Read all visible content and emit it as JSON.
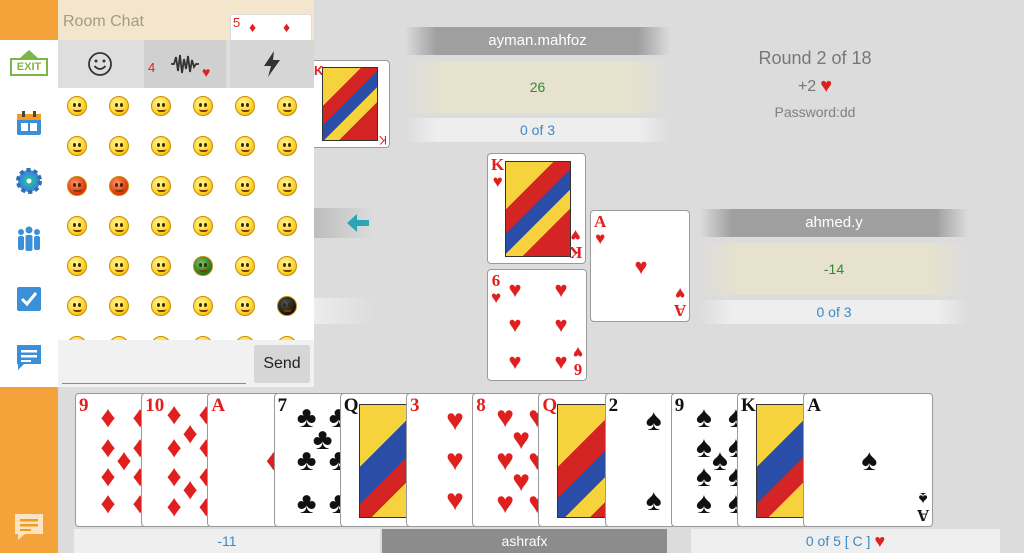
{
  "sidebar": {
    "exit_label": "EXIT",
    "buttons": [
      "calendar-icon",
      "settings-gear-icon",
      "players-icon",
      "checklist-icon",
      "notes-icon",
      "chat-bubble-icon"
    ],
    "accent": "#f3a33a"
  },
  "chat": {
    "title": "Room Chat",
    "tabs": [
      "emoji-tab",
      "sounds-tab",
      "actions-tab"
    ],
    "input_value": "",
    "send_label": "Send"
  },
  "players": {
    "top": {
      "name": "ayman.mahfoz",
      "score": "26",
      "tricks": "0 of 3"
    },
    "right": {
      "name": "ahmed.y",
      "score": "-14",
      "tricks": "0 of 3"
    },
    "me": {
      "name": "ashrafx",
      "score": "-11",
      "tricks": "0 of 5 [ C ]"
    }
  },
  "round": {
    "label": "Round 2 of 18",
    "bid": "+2",
    "bid_suit": "hearts",
    "password": "Password:dd"
  },
  "table": {
    "played": [
      {
        "rank": "K",
        "suit": "hearts",
        "player": "top"
      },
      {
        "rank": "A",
        "suit": "hearts",
        "player": "right"
      },
      {
        "rank": "6",
        "suit": "hearts",
        "player": "me"
      }
    ],
    "last_trick_top": {
      "rank": "K",
      "suit": "diamonds"
    },
    "turn_arrow": "left"
  },
  "hand": [
    {
      "rank": "9",
      "suit": "diamonds"
    },
    {
      "rank": "10",
      "suit": "diamonds"
    },
    {
      "rank": "A",
      "suit": "diamonds"
    },
    {
      "rank": "7",
      "suit": "clubs"
    },
    {
      "rank": "Q",
      "suit": "clubs"
    },
    {
      "rank": "3",
      "suit": "hearts"
    },
    {
      "rank": "8",
      "suit": "hearts"
    },
    {
      "rank": "Q",
      "suit": "hearts"
    },
    {
      "rank": "2",
      "suit": "spades"
    },
    {
      "rank": "9",
      "suit": "spades"
    },
    {
      "rank": "K",
      "suit": "spades"
    },
    {
      "rank": "A",
      "suit": "spades"
    }
  ],
  "colors": {
    "red_suit": "#e0201e",
    "black_suit": "#111111",
    "score_green": "#2f8b2f",
    "tricks_blue": "#3b8ac4"
  }
}
